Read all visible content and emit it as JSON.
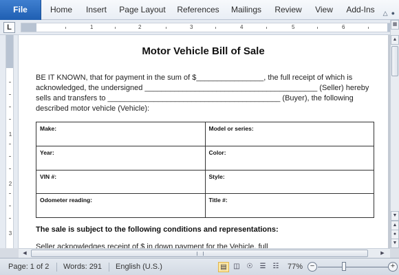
{
  "ribbon": {
    "file_tab": "File",
    "tabs": [
      "Home",
      "Insert",
      "Page Layout",
      "References",
      "Mailings",
      "Review",
      "View",
      "Add-Ins"
    ],
    "icons": [
      "minimize-ribbon-icon",
      "help-icon"
    ]
  },
  "ruler": {
    "corner_label": "L",
    "numbers": [
      "1",
      "2",
      "3",
      "4",
      "5",
      "6"
    ],
    "vertical_numbers": [
      "1",
      "2",
      "3"
    ]
  },
  "document": {
    "title": "Motor Vehicle Bill of Sale",
    "paragraph_lines": [
      "BE IT KNOWN,  that for payment in the sum of $________________,   the full receipt of which is",
      "acknowledged, the undersigned _________________________________________   (Seller) hereby",
      "sells and transfers to _________________________________________   (Buyer), the following",
      "described motor vehicle (Vehicle):"
    ],
    "table": [
      [
        "Make:",
        "Model or series:"
      ],
      [
        "Year:",
        "Color:"
      ],
      [
        "VIN #:",
        "Style:"
      ],
      [
        "Odometer reading:",
        "Title #:"
      ]
    ],
    "conditions_heading": "The sale is subject to the following conditions and representations:",
    "clipped_line": "Seller acknowledges receipt of $                               in down payment for the Vehicle, full"
  },
  "status_bar": {
    "page": "Page: 1 of 2",
    "words": "Words: 291",
    "language": "English (U.S.)",
    "zoom": "77%",
    "zoom_out": "−",
    "zoom_in": "+",
    "zoom_level_fraction": 0.5,
    "view_icons": [
      "print-layout-icon",
      "full-screen-reading-icon",
      "web-layout-icon",
      "outline-icon",
      "draft-icon"
    ]
  },
  "colors": {
    "file_tab": "#2a6ac1",
    "accent_selected_view": "#fde7a3"
  }
}
